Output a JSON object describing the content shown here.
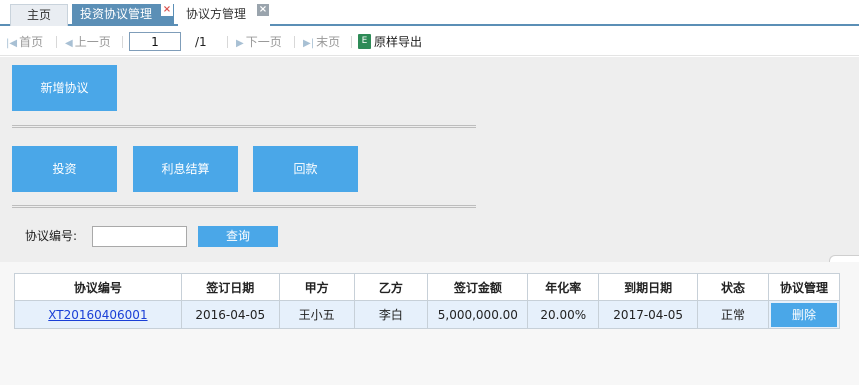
{
  "tabs": {
    "home": "主页",
    "active": "投资协议管理",
    "party": "协议方管理",
    "close_glyph": "×"
  },
  "pager": {
    "first": "首页",
    "prev": "上一页",
    "current_page": "1",
    "total": "/1",
    "next": "下一页",
    "last": "末页",
    "export": "原样导出",
    "excel_glyph": "E"
  },
  "actions": {
    "add": "新增协议",
    "invest": "投资",
    "interest": "利息结算",
    "repay": "回款"
  },
  "search": {
    "label": "协议编号:",
    "value": "",
    "button": "查询"
  },
  "table": {
    "headers": [
      "协议编号",
      "签订日期",
      "甲方",
      "乙方",
      "签订金额",
      "年化率",
      "到期日期",
      "状态",
      "协议管理"
    ],
    "rows": [
      {
        "id": "XT20160406001",
        "sign_date": "2016-04-05",
        "party_a": "王小五",
        "party_b": "李白",
        "amount": "5,000,000.00",
        "rate": "20.00%",
        "due_date": "2017-04-05",
        "status": "正常",
        "action": "删除"
      }
    ]
  },
  "colors": {
    "accent": "#4aa7e8",
    "tab_active": "#5b8fb6",
    "row_bg": "#e6f0fb"
  }
}
